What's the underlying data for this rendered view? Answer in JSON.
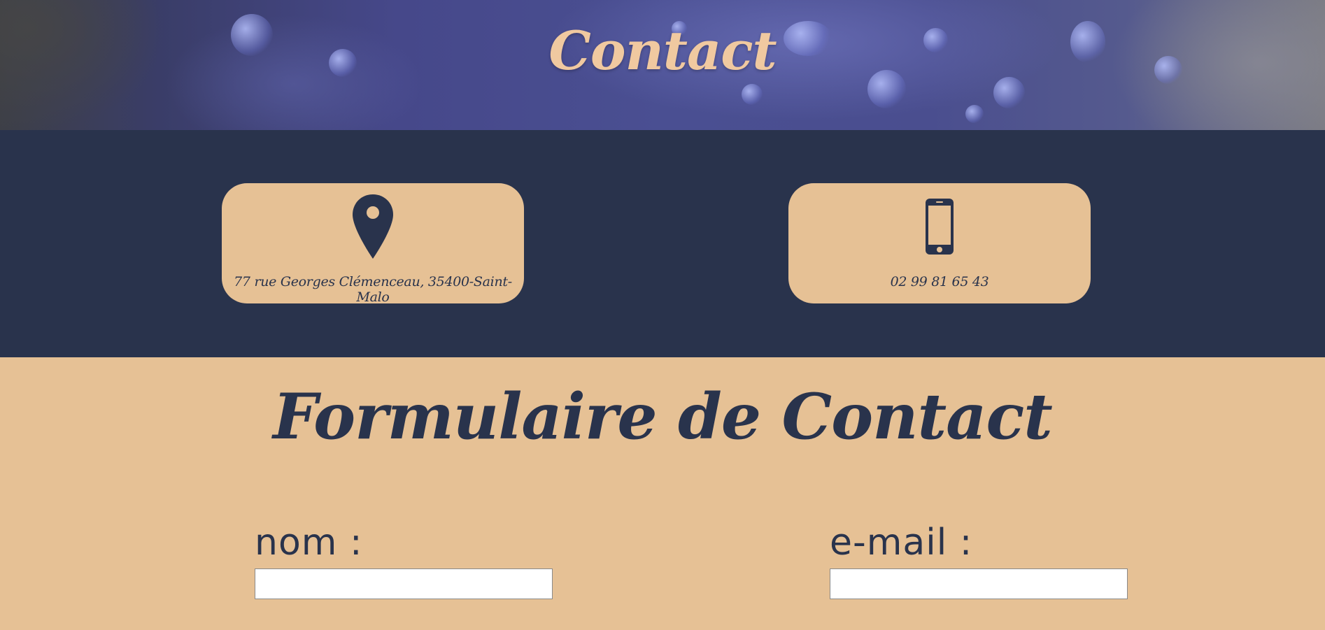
{
  "hero": {
    "title": "Contact"
  },
  "info": {
    "address": {
      "icon": "map-pin-icon",
      "text": "77 rue Georges Clémenceau, 35400-Saint-Malo"
    },
    "phone": {
      "icon": "smartphone-icon",
      "text": "02 99 81 65 43"
    }
  },
  "form": {
    "title": "Formulaire de Contact",
    "fields": {
      "name": {
        "label": "nom :",
        "value": ""
      },
      "email": {
        "label": "e-mail :",
        "value": ""
      }
    }
  },
  "colors": {
    "navy": "#29334c",
    "sand": "#e6c195",
    "hero_title": "#f0c9a0"
  }
}
